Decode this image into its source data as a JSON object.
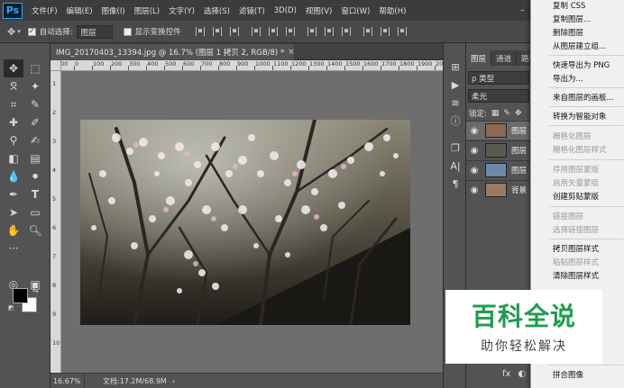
{
  "app": {
    "logo": "Ps"
  },
  "menubar": {
    "items": [
      "文件(F)",
      "编辑(E)",
      "图像(I)",
      "图层(L)",
      "文字(Y)",
      "选择(S)",
      "滤镜(T)",
      "3D(D)",
      "视图(V)",
      "窗口(W)",
      "帮助(H)"
    ],
    "minimize": "–"
  },
  "options": {
    "auto_select_label": "自动选择:",
    "auto_select_value": "图层",
    "show_transform_label": "显示变换控件"
  },
  "document": {
    "tab_title": "IMG_20170403_13394.jpg @ 16.7% (图层 1 拷贝 2, RGB/8) *",
    "close": "×",
    "ruler_h_labels": [
      "100",
      "0",
      "100",
      "200",
      "300",
      "400",
      "500",
      "600",
      "700",
      "800",
      "900",
      "1000",
      "1100",
      "1200",
      "1300",
      "1400",
      "1500",
      "1600",
      "1700",
      "1800",
      "1900",
      "2000",
      "2100",
      "2200",
      "2300"
    ],
    "ruler_v_labels": [
      "1",
      "2",
      "3",
      "4",
      "5",
      "6",
      "7",
      "8",
      "9",
      "10"
    ]
  },
  "status": {
    "zoom": "16.67%",
    "doc_info": "文档:17.2M/68.9M",
    "arrow": "›"
  },
  "layers_panel": {
    "tabs": [
      "图层",
      "通道",
      "路径"
    ],
    "filter_label": "ρ 类型",
    "blend_mode": "柔光",
    "lock_label": "锁定:",
    "layers": [
      {
        "name": "图层",
        "selected": true
      },
      {
        "name": "图层",
        "selected": false
      },
      {
        "name": "图层",
        "selected": false
      },
      {
        "name": "背景",
        "selected": false
      }
    ],
    "footer_icons": [
      "fx",
      "◐",
      "▢"
    ]
  },
  "context_menu": {
    "items": [
      {
        "label": "复制 CSS",
        "disabled": false
      },
      {
        "label": "复制图层...",
        "disabled": false
      },
      {
        "label": "删除图层",
        "disabled": false
      },
      {
        "label": "从图层建立组...",
        "disabled": false
      },
      {
        "label": "快速导出为 PNG",
        "disabled": false
      },
      {
        "label": "导出为...",
        "disabled": false
      },
      {
        "label": "来自图层的画板...",
        "disabled": false
      },
      {
        "label": "转换为智能对象",
        "disabled": false
      },
      {
        "label": "栅格化图层",
        "disabled": true
      },
      {
        "label": "栅格化图层样式",
        "disabled": true
      },
      {
        "label": "停用图层蒙版",
        "disabled": true
      },
      {
        "label": "启用矢量蒙版",
        "disabled": true
      },
      {
        "label": "创建剪贴蒙版",
        "disabled": false
      },
      {
        "label": "链接图层",
        "disabled": true
      },
      {
        "label": "选择链接图层",
        "disabled": true
      },
      {
        "label": "拷贝图层样式",
        "disabled": false
      },
      {
        "label": "粘贴图层样式",
        "disabled": true
      },
      {
        "label": "清除图层样式",
        "disabled": false
      },
      {
        "label": "拼合图像",
        "disabled": false
      }
    ]
  },
  "watermark": {
    "title": "百科全说",
    "subtitle": "助你轻松解决"
  },
  "colors": {
    "accent": "#31a8ff",
    "watermark_green": "#1f9d4e",
    "foreground": "#000000",
    "background": "#ffffff"
  }
}
